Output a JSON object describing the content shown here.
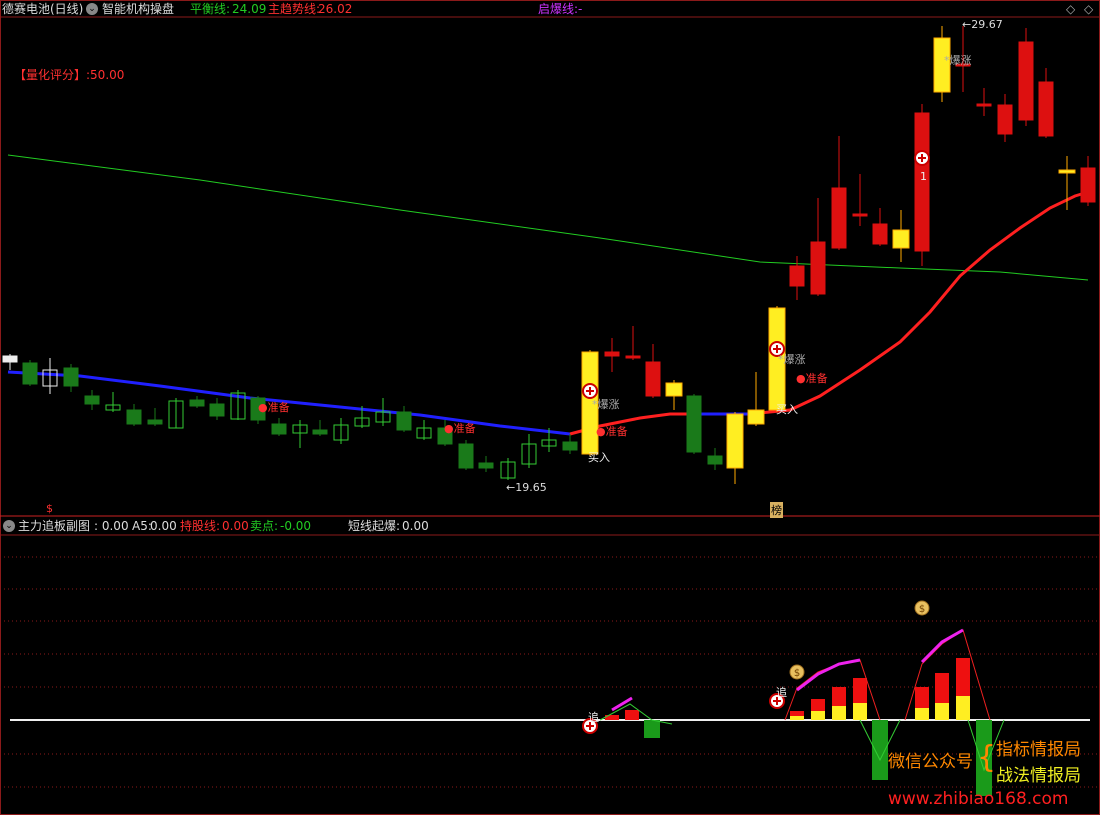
{
  "header": {
    "stock_title": "德赛电池(日线)",
    "indicator_name": "智能机构操盘",
    "balance_label": "平衡线:",
    "balance_value": "24.09",
    "trend_label": "主趋势线:",
    "trend_value": "26.02",
    "burst_label": "启爆线:",
    "burst_value": "-"
  },
  "score": {
    "label": "【量化评分】",
    "value": ":50.00"
  },
  "sub_header": {
    "name": "主力追板副图",
    "name_value": ": 0.00",
    "a5_label": "A5:",
    "a5_value": "0.00",
    "hold_label": "持股线:",
    "hold_value": "0.00",
    "sell_label": "卖点:",
    "sell_value": "-0.00",
    "short_label": "短线起爆:",
    "short_value": "0.00"
  },
  "annotations": {
    "high": "29.67",
    "low": "19.65",
    "burst1": "爆涨",
    "burst2": "爆涨",
    "burst3": "爆涨",
    "ready1": "准备",
    "ready2": "准备",
    "ready3": "准备",
    "ready4": "准备",
    "buy1": "买入",
    "buy2": "买入",
    "marker1": "1",
    "chase1": "追",
    "chase2": "追",
    "s_marker": "$",
    "board_marker": "榜"
  },
  "watermark": {
    "wechat": "微信公众号",
    "line1": "指标情报局",
    "line2": "战法情报局",
    "url": "www.zhibiao168.com"
  },
  "colors": {
    "up": "#ff2020",
    "down": "#1a7a1a",
    "yellow": "#ffee22",
    "trend": "#ff2020",
    "blue": "#2020ff",
    "green_line": "#22cc22",
    "magenta": "#ee22ee",
    "grid": "#8b1a1a"
  },
  "chart_data": {
    "type": "candlestick",
    "price_range": [
      19.0,
      30.0
    ],
    "high": 29.67,
    "low": 19.65,
    "balance_line": 24.09,
    "trend_line": 26.02
  }
}
